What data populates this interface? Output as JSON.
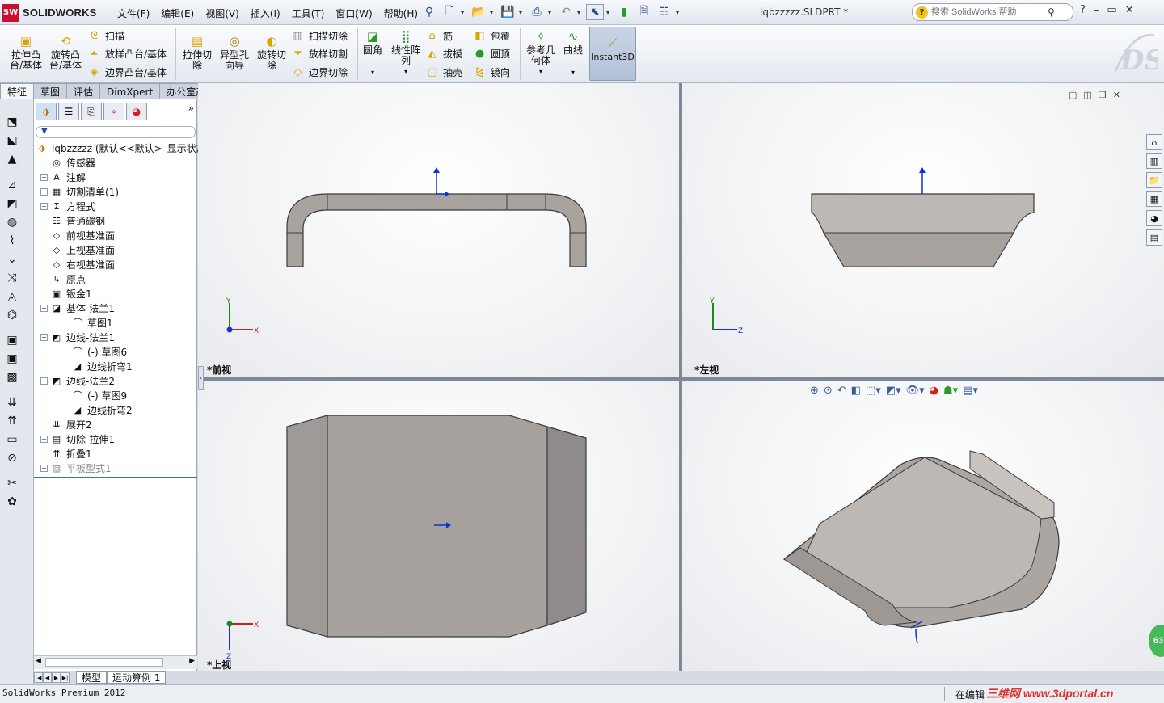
{
  "app": {
    "brand": "SOLIDWORKS",
    "brand_mark": "SW",
    "doc_title": "lqbzzzzz.SLDPRT *"
  },
  "menu": [
    "文件(F)",
    "编辑(E)",
    "视图(V)",
    "插入(I)",
    "工具(T)",
    "窗口(W)",
    "帮助(H)"
  ],
  "search": {
    "placeholder": "搜索 SolidWorks 帮助"
  },
  "window_controls": {
    "minimize": "–",
    "restore": "▭",
    "close": "✕",
    "help": "?"
  },
  "ribbon": {
    "extrude_boss": "拉伸凸\n台/基体",
    "revolve_boss": "旋转凸\n台/基体",
    "sweep": "扫描",
    "loft_boss": "放样凸台/基体",
    "boundary_boss": "边界凸台/基体",
    "extrude_cut": "拉伸切\n除",
    "hole_wizard": "异型孔\n向导",
    "revolve_cut": "旋转切\n除",
    "swept_cut": "扫描切除",
    "lofted_cut": "放样切割",
    "boundary_cut": "边界切除",
    "fillet": "圆角",
    "linear_pattern": "线性阵\n列",
    "rib": "筋",
    "draft": "拔模",
    "shell": "抽壳",
    "wrap": "包覆",
    "dome": "圆顶",
    "mirror": "镜向",
    "ref_geometry": "参考几\n何体",
    "curves": "曲线",
    "instant3d": "Instant3D"
  },
  "tabs": [
    "特征",
    "草图",
    "评估",
    "DimXpert",
    "办公室产品"
  ],
  "active_tab": "特征",
  "tree": {
    "root": "lqbzzzzz  (默认<<默认>_显示状态",
    "items": [
      {
        "label": "传感器",
        "icon": "sensor-icon",
        "level": 1,
        "expand": ""
      },
      {
        "label": "注解",
        "icon": "annotation-icon",
        "level": 1,
        "expand": "+"
      },
      {
        "label": "切割清单(1)",
        "icon": "cutlist-icon",
        "level": 1,
        "expand": "+"
      },
      {
        "label": "方程式",
        "icon": "equation-icon",
        "level": 1,
        "expand": "+"
      },
      {
        "label": "普通碳钢",
        "icon": "material-icon",
        "level": 1,
        "expand": ""
      },
      {
        "label": "前视基准面",
        "icon": "plane-icon",
        "level": 1,
        "expand": ""
      },
      {
        "label": "上视基准面",
        "icon": "plane-icon",
        "level": 1,
        "expand": ""
      },
      {
        "label": "右视基准面",
        "icon": "plane-icon",
        "level": 1,
        "expand": ""
      },
      {
        "label": "原点",
        "icon": "origin-icon",
        "level": 1,
        "expand": ""
      },
      {
        "label": "钣金1",
        "icon": "sheetmetal-icon",
        "level": 1,
        "expand": ""
      },
      {
        "label": "基体-法兰1",
        "icon": "base-flange-icon",
        "level": 1,
        "expand": "−"
      },
      {
        "label": "草图1",
        "icon": "sketch-icon",
        "level": 2,
        "expand": ""
      },
      {
        "label": "边线-法兰1",
        "icon": "edge-flange-icon",
        "level": 1,
        "expand": "−"
      },
      {
        "label": "(-) 草图6",
        "icon": "sketch-icon",
        "level": 2,
        "expand": ""
      },
      {
        "label": "边线折弯1",
        "icon": "bend-icon",
        "level": 2,
        "expand": ""
      },
      {
        "label": "边线-法兰2",
        "icon": "edge-flange-icon",
        "level": 1,
        "expand": "−"
      },
      {
        "label": "(-) 草图9",
        "icon": "sketch-icon",
        "level": 2,
        "expand": ""
      },
      {
        "label": "边线折弯2",
        "icon": "bend-icon",
        "level": 2,
        "expand": ""
      },
      {
        "label": "展开2",
        "icon": "unfold-icon",
        "level": 1,
        "expand": ""
      },
      {
        "label": "切除-拉伸1",
        "icon": "cut-extrude-icon",
        "level": 1,
        "expand": "+"
      },
      {
        "label": "折叠1",
        "icon": "fold-icon",
        "level": 1,
        "expand": ""
      },
      {
        "label": "平板型式1",
        "icon": "flat-pattern-icon",
        "level": 1,
        "expand": "+",
        "suppressed": true
      }
    ]
  },
  "filter_glyph": "▼",
  "bottom_tabs": [
    "模型",
    "运动算例 1"
  ],
  "viewports": {
    "front": "*前视",
    "left": "*左视",
    "top": "*上视"
  },
  "axes": {
    "x": "X",
    "y": "Y",
    "z": "Z"
  },
  "status": {
    "app_version": "SolidWorks Premium 2012",
    "mode": "在编辑",
    "watermark": "三维网 www.3dportal.cn"
  },
  "badge": "63",
  "colors": {
    "part_face": "#a6a19c",
    "part_edge": "#3c3c3c",
    "accent": "#3d6fbf",
    "axis_red": "#cc2020",
    "axis_green": "#1a8a1a",
    "axis_blue": "#2030c0"
  }
}
